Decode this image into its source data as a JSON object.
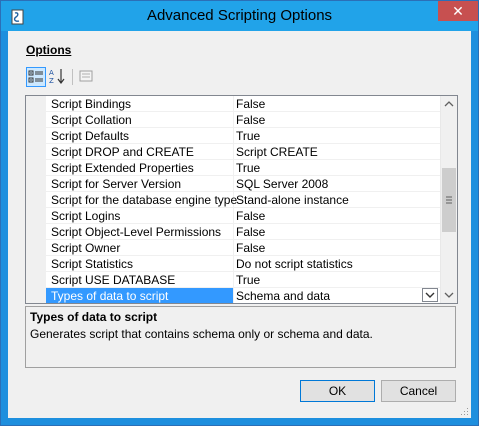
{
  "window": {
    "title": "Advanced Scripting Options",
    "close_glyph": "✕"
  },
  "options": {
    "label": "Options"
  },
  "toolbar": {
    "categorized_icon": "categorized-icon",
    "alphabetical_icon": "alphabetical-icon",
    "property_pages_icon": "property-pages-icon",
    "sort_glyph": "A↓Z"
  },
  "grid": {
    "rows": [
      {
        "name": "Script Bindings",
        "value": "False"
      },
      {
        "name": "Script Collation",
        "value": "False"
      },
      {
        "name": "Script Defaults",
        "value": "True"
      },
      {
        "name": "Script DROP and CREATE",
        "value": "Script CREATE"
      },
      {
        "name": "Script Extended Properties",
        "value": "True"
      },
      {
        "name": "Script for Server Version",
        "value": "SQL Server 2008"
      },
      {
        "name": "Script for the database engine type",
        "value": "Stand-alone instance"
      },
      {
        "name": "Script Logins",
        "value": "False"
      },
      {
        "name": "Script Object-Level Permissions",
        "value": "False"
      },
      {
        "name": "Script Owner",
        "value": "False"
      },
      {
        "name": "Script Statistics",
        "value": "Do not script statistics"
      },
      {
        "name": "Script USE DATABASE",
        "value": "True"
      },
      {
        "name": "Types of data to script",
        "value": "Schema and data",
        "selected": true
      }
    ],
    "scroll_up_glyph": "▲",
    "scroll_down_glyph": "▼",
    "dropdown_glyph": "▾"
  },
  "description": {
    "title": "Types of data to script",
    "text": "Generates script that contains schema only or schema and data."
  },
  "buttons": {
    "ok": "OK",
    "cancel": "Cancel"
  },
  "colors": {
    "titlebar": "#21a3e9",
    "selection": "#3399ff",
    "close": "#c75050"
  }
}
